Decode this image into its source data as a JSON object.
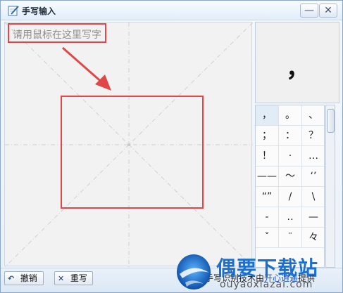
{
  "window": {
    "title": "手写输入",
    "minimize_glyph": "—",
    "close_glyph": "✕"
  },
  "canvas": {
    "hint": "请用鼠标在这里写字"
  },
  "preview": {
    "char": "，"
  },
  "candidates": [
    [
      "，",
      "。",
      "、"
    ],
    [
      "；",
      "：",
      "？"
    ],
    [
      "！",
      "·",
      "…"
    ],
    [
      "——",
      "～",
      "‘’"
    ],
    [
      "“”",
      "/",
      "\\"
    ],
    [
      "-",
      "‥",
      "—"
    ],
    [
      "ˇ",
      "¨",
      "々"
    ]
  ],
  "buttons": {
    "undo": "撤销",
    "rewrite": "重写"
  },
  "credit": {
    "prefix": "手写识别技术由",
    "link": "开心逍遥",
    "suffix": "提供"
  },
  "watermark": {
    "title": "偶要下载站",
    "url": "ouyaoxiazai.com"
  },
  "colors": {
    "annotation": "#e04848",
    "brand": "#1a6fd0"
  }
}
